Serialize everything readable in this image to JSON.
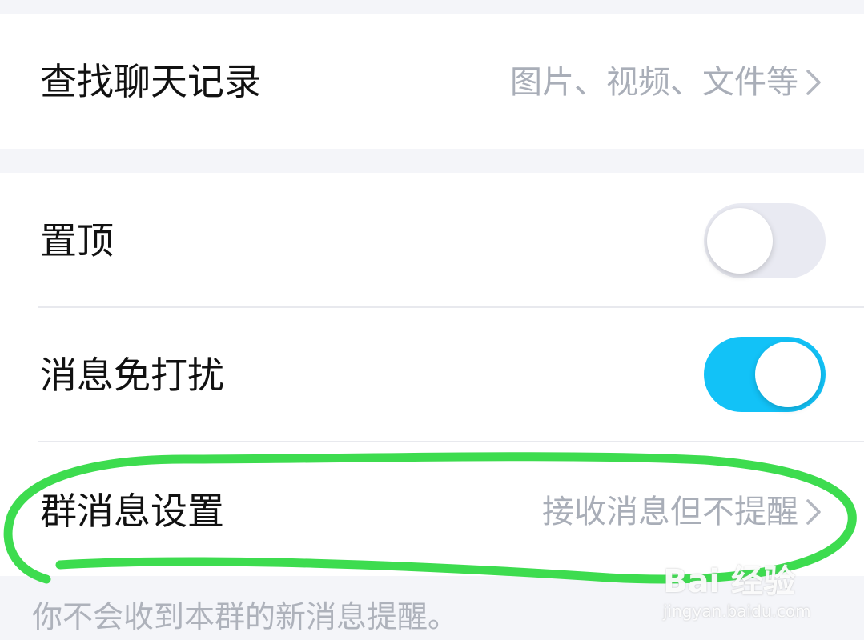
{
  "rows": {
    "search_history": {
      "label": "查找聊天记录",
      "value": "图片、视频、文件等"
    },
    "pin_top": {
      "label": "置顶",
      "toggle_on": false
    },
    "do_not_disturb": {
      "label": "消息免打扰",
      "toggle_on": true
    },
    "group_message_settings": {
      "label": "群消息设置",
      "value": "接收消息但不提醒"
    }
  },
  "footnote": "你不会收到本群的新消息提醒。",
  "watermark": {
    "brand": "Bai 经验",
    "url": "jingyan.baidu.com"
  },
  "colors": {
    "toggle_on": "#12c2f7",
    "toggle_off": "#e9eaf2",
    "annotation_stroke": "#3ddc4f",
    "background": "#f4f5f9"
  },
  "icons": {
    "chevron": "chevron-right-icon"
  }
}
